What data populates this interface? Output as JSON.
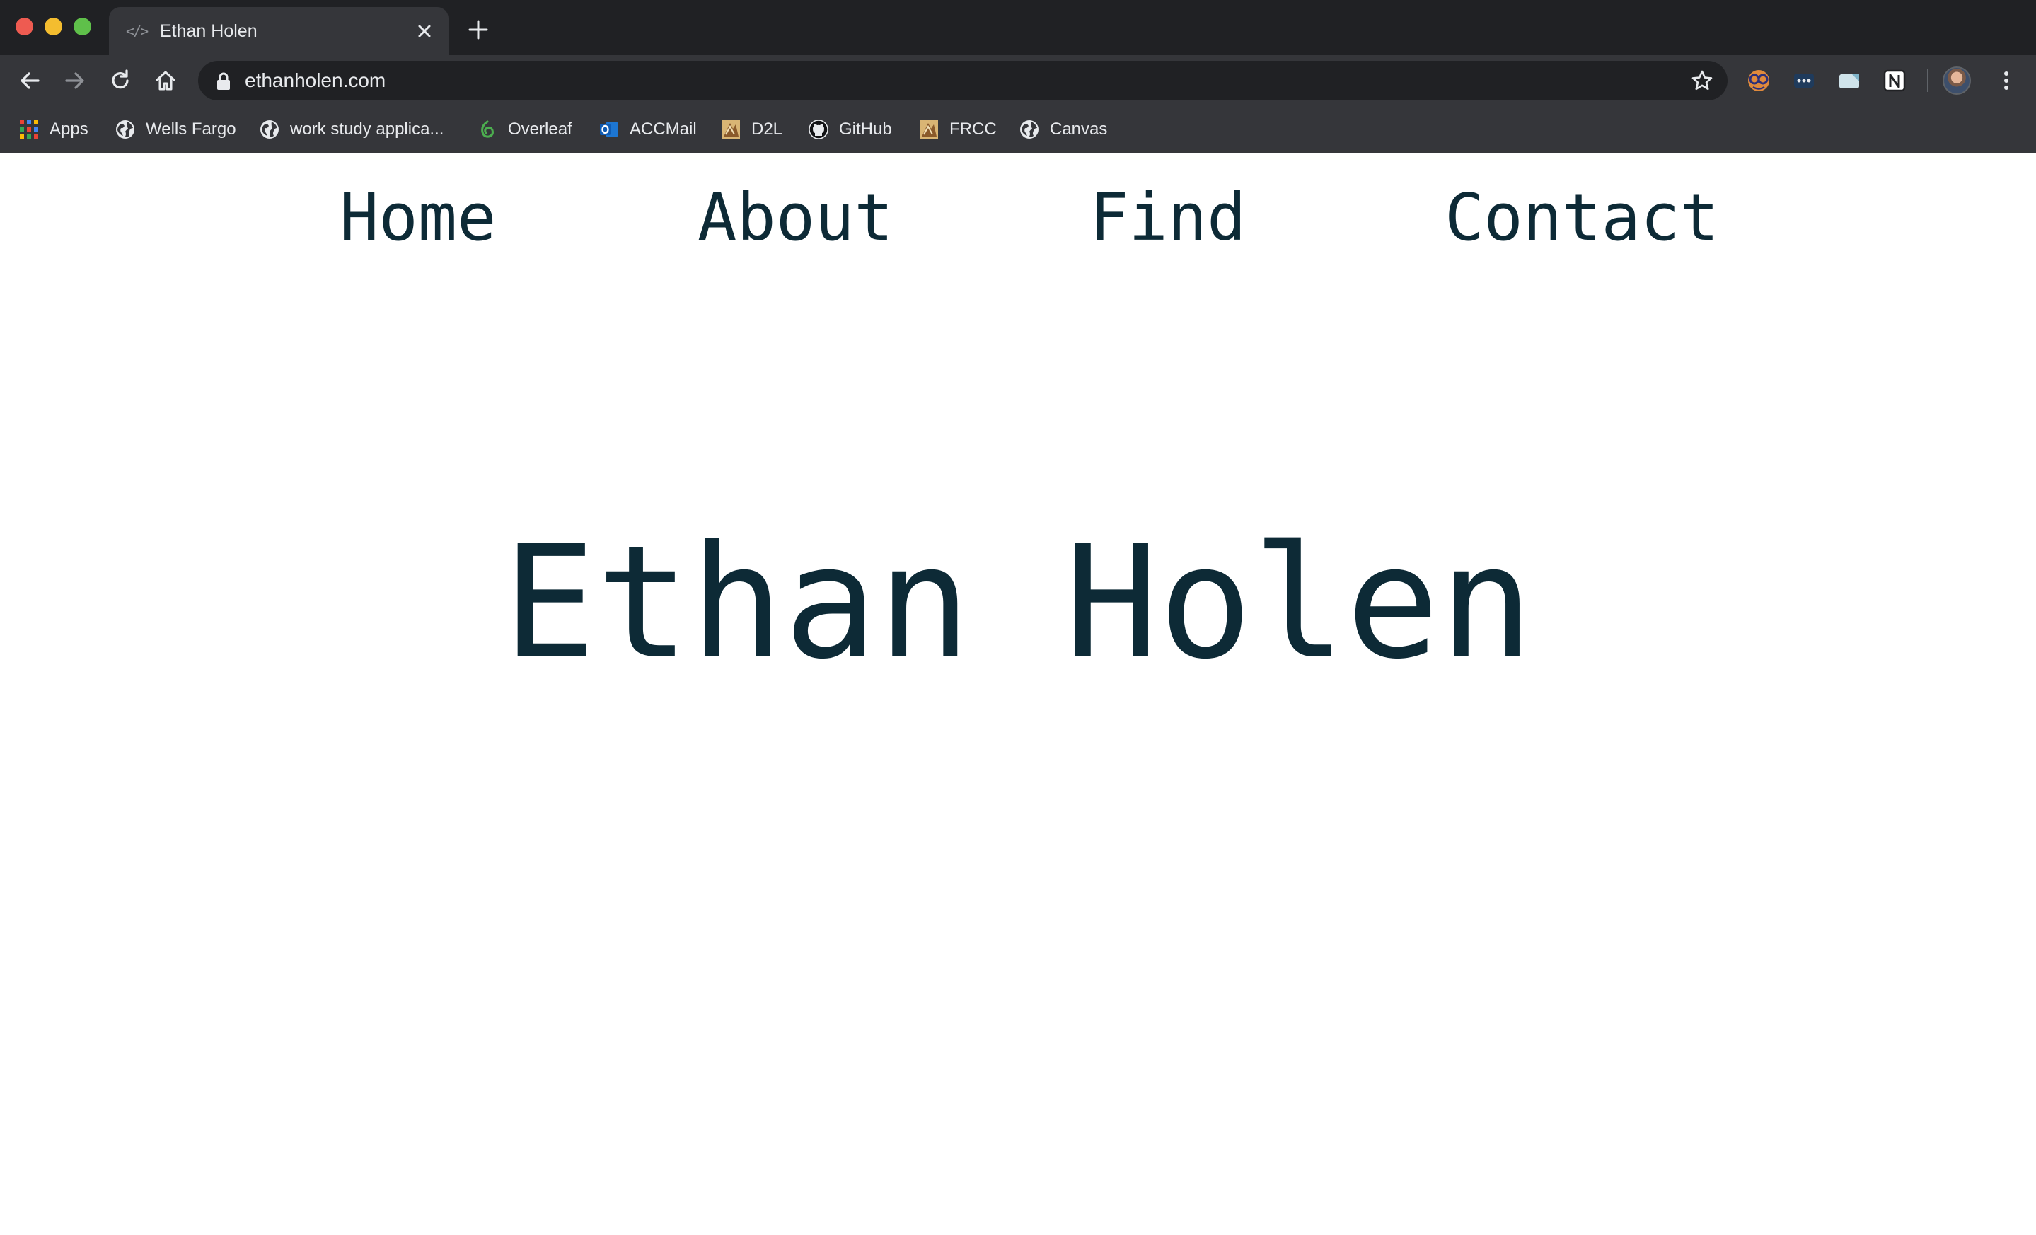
{
  "window": {
    "tab": {
      "title": "Ethan Holen",
      "favicon": "code-icon"
    }
  },
  "toolbar": {
    "url": "ethanholen.com"
  },
  "bookmarks": [
    {
      "label": "Apps",
      "icon": "apps-grid-icon"
    },
    {
      "label": "Wells Fargo",
      "icon": "globe-icon"
    },
    {
      "label": "work study applica...",
      "icon": "globe-icon"
    },
    {
      "label": "Overleaf",
      "icon": "overleaf-icon"
    },
    {
      "label": "ACCMail",
      "icon": "outlook-icon"
    },
    {
      "label": "D2L",
      "icon": "d2l-icon"
    },
    {
      "label": "GitHub",
      "icon": "github-icon"
    },
    {
      "label": "FRCC",
      "icon": "frcc-icon"
    },
    {
      "label": "Canvas",
      "icon": "globe-icon"
    }
  ],
  "page": {
    "nav": [
      {
        "label": "Home"
      },
      {
        "label": "About"
      },
      {
        "label": "Find"
      },
      {
        "label": "Contact"
      }
    ],
    "hero_title": "Ethan Holen"
  },
  "colors": {
    "page_text": "#0d2a36",
    "chrome_dark": "#202124",
    "chrome_toolbar": "#35363a"
  }
}
